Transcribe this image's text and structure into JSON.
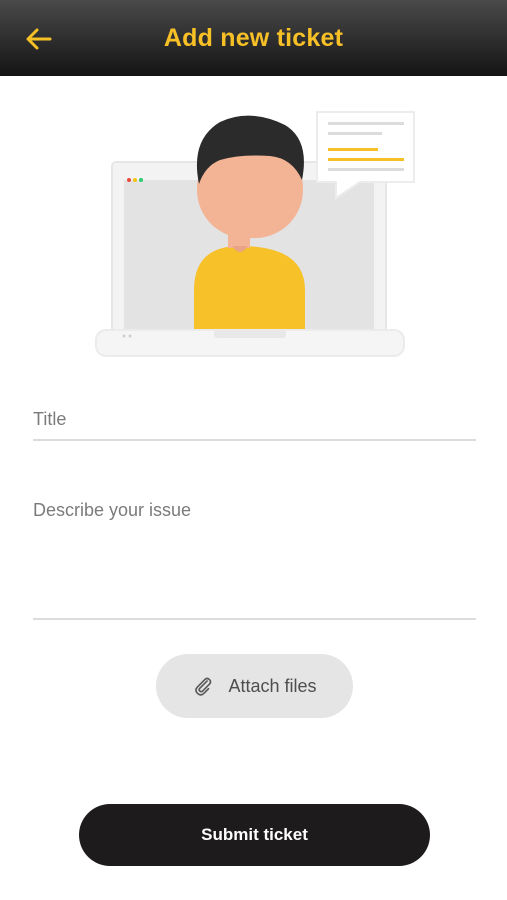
{
  "header": {
    "title": "Add new ticket",
    "back_icon": "arrow-left-icon",
    "background": "#1e1e1e",
    "accent": "#f6c026"
  },
  "illustration": {
    "name": "support-agent-on-laptop-illustration"
  },
  "form": {
    "title_placeholder": "Title",
    "title_value": "",
    "description_placeholder": "Describe your issue",
    "description_value": "",
    "attach_label": "Attach files",
    "attach_icon": "paperclip-icon",
    "submit_label": "Submit ticket"
  }
}
